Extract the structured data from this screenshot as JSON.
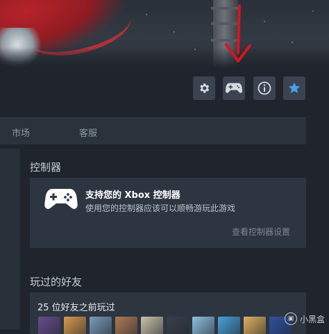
{
  "toolbar": {
    "buttons": [
      {
        "icon": "gear-icon"
      },
      {
        "icon": "gamepad-icon"
      },
      {
        "icon": "info-icon"
      },
      {
        "icon": "star-icon",
        "color": "#4a9de8"
      }
    ],
    "highlight_arrow_color": "#d8141f"
  },
  "tabs": [
    "市场",
    "客服"
  ],
  "controller": {
    "section_title": "控制器",
    "card_title": "支持您的 Xbox 控制器",
    "card_desc": "使用您的控制器应该可以顺畅游玩此游戏",
    "settings_link": "查看控制器设置"
  },
  "friends": {
    "section_title": "玩过的好友",
    "count_text": "25 位好友之前玩过",
    "avatar_colors": [
      "#6a4b8c",
      "#d99a4a",
      "#7a9ab8",
      "#b07a56",
      "#c9c2a8",
      "#3a3f4a",
      "#8ec0e0",
      "#4aa0d8",
      "#e0b060",
      "#3050a0"
    ]
  },
  "watermark": {
    "text": "小黑盒"
  }
}
